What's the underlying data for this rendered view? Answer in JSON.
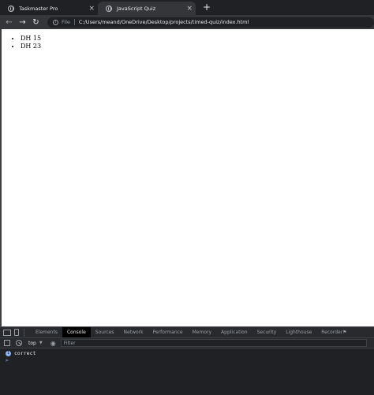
{
  "browser": {
    "tabs": [
      {
        "title": "Taskmaster Pro",
        "active": false
      },
      {
        "title": "JavaScript Quiz",
        "active": true
      }
    ],
    "new_tab_glyph": "+",
    "close_glyph": "×",
    "omnibox": {
      "scheme_label": "File",
      "url": "C:/Users/meand/OneDrive/Desktop/projects/timed-quiz/index.html"
    }
  },
  "page": {
    "list_items": [
      "DH 15",
      "DH 23"
    ]
  },
  "devtools": {
    "tabs": [
      "Elements",
      "Console",
      "Sources",
      "Network",
      "Performance",
      "Memory",
      "Application",
      "Security",
      "Lighthouse",
      "Recorder"
    ],
    "active_tab": "Console",
    "context": "top",
    "filter_placeholder": "Filter",
    "console_messages": [
      {
        "text": "correct",
        "count": "1"
      }
    ],
    "prompt_glyph": ">"
  },
  "colors": {
    "accent": "#8ab4f8",
    "chrome_dark": "#202124",
    "chrome_toolbar": "#35363a"
  }
}
